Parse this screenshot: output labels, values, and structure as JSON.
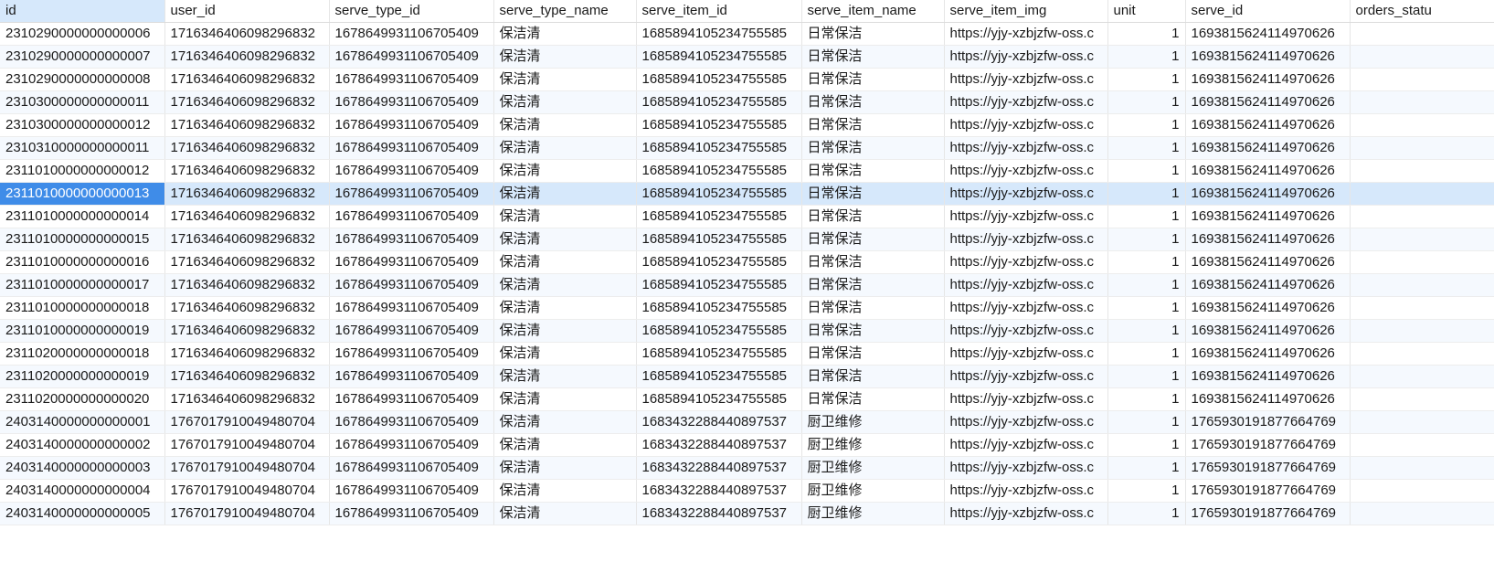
{
  "columns": [
    {
      "key": "id",
      "label": "id"
    },
    {
      "key": "user_id",
      "label": "user_id"
    },
    {
      "key": "serve_type_id",
      "label": "serve_type_id"
    },
    {
      "key": "serve_type_name",
      "label": "serve_type_name"
    },
    {
      "key": "serve_item_id",
      "label": "serve_item_id"
    },
    {
      "key": "serve_item_name",
      "label": "serve_item_name"
    },
    {
      "key": "serve_item_img",
      "label": "serve_item_img"
    },
    {
      "key": "unit",
      "label": "unit"
    },
    {
      "key": "serve_id",
      "label": "serve_id"
    },
    {
      "key": "orders_status",
      "label": "orders_statu"
    }
  ],
  "selected_row": 7,
  "rows": [
    [
      "2310290000000000006",
      "1716346406098296832",
      "1678649931106705409",
      "保洁清",
      "1685894105234755585",
      "日常保洁",
      "https://yjy-xzbjzfw-oss.c",
      "1",
      "1693815624114970626",
      ""
    ],
    [
      "2310290000000000007",
      "1716346406098296832",
      "1678649931106705409",
      "保洁清",
      "1685894105234755585",
      "日常保洁",
      "https://yjy-xzbjzfw-oss.c",
      "1",
      "1693815624114970626",
      ""
    ],
    [
      "2310290000000000008",
      "1716346406098296832",
      "1678649931106705409",
      "保洁清",
      "1685894105234755585",
      "日常保洁",
      "https://yjy-xzbjzfw-oss.c",
      "1",
      "1693815624114970626",
      ""
    ],
    [
      "2310300000000000011",
      "1716346406098296832",
      "1678649931106705409",
      "保洁清",
      "1685894105234755585",
      "日常保洁",
      "https://yjy-xzbjzfw-oss.c",
      "1",
      "1693815624114970626",
      ""
    ],
    [
      "2310300000000000012",
      "1716346406098296832",
      "1678649931106705409",
      "保洁清",
      "1685894105234755585",
      "日常保洁",
      "https://yjy-xzbjzfw-oss.c",
      "1",
      "1693815624114970626",
      ""
    ],
    [
      "2310310000000000011",
      "1716346406098296832",
      "1678649931106705409",
      "保洁清",
      "1685894105234755585",
      "日常保洁",
      "https://yjy-xzbjzfw-oss.c",
      "1",
      "1693815624114970626",
      ""
    ],
    [
      "2311010000000000012",
      "1716346406098296832",
      "1678649931106705409",
      "保洁清",
      "1685894105234755585",
      "日常保洁",
      "https://yjy-xzbjzfw-oss.c",
      "1",
      "1693815624114970626",
      ""
    ],
    [
      "2311010000000000013",
      "1716346406098296832",
      "1678649931106705409",
      "保洁清",
      "1685894105234755585",
      "日常保洁",
      "https://yjy-xzbjzfw-oss.c",
      "1",
      "1693815624114970626",
      ""
    ],
    [
      "2311010000000000014",
      "1716346406098296832",
      "1678649931106705409",
      "保洁清",
      "1685894105234755585",
      "日常保洁",
      "https://yjy-xzbjzfw-oss.c",
      "1",
      "1693815624114970626",
      ""
    ],
    [
      "2311010000000000015",
      "1716346406098296832",
      "1678649931106705409",
      "保洁清",
      "1685894105234755585",
      "日常保洁",
      "https://yjy-xzbjzfw-oss.c",
      "1",
      "1693815624114970626",
      ""
    ],
    [
      "2311010000000000016",
      "1716346406098296832",
      "1678649931106705409",
      "保洁清",
      "1685894105234755585",
      "日常保洁",
      "https://yjy-xzbjzfw-oss.c",
      "1",
      "1693815624114970626",
      ""
    ],
    [
      "2311010000000000017",
      "1716346406098296832",
      "1678649931106705409",
      "保洁清",
      "1685894105234755585",
      "日常保洁",
      "https://yjy-xzbjzfw-oss.c",
      "1",
      "1693815624114970626",
      ""
    ],
    [
      "2311010000000000018",
      "1716346406098296832",
      "1678649931106705409",
      "保洁清",
      "1685894105234755585",
      "日常保洁",
      "https://yjy-xzbjzfw-oss.c",
      "1",
      "1693815624114970626",
      ""
    ],
    [
      "2311010000000000019",
      "1716346406098296832",
      "1678649931106705409",
      "保洁清",
      "1685894105234755585",
      "日常保洁",
      "https://yjy-xzbjzfw-oss.c",
      "1",
      "1693815624114970626",
      ""
    ],
    [
      "2311020000000000018",
      "1716346406098296832",
      "1678649931106705409",
      "保洁清",
      "1685894105234755585",
      "日常保洁",
      "https://yjy-xzbjzfw-oss.c",
      "1",
      "1693815624114970626",
      ""
    ],
    [
      "2311020000000000019",
      "1716346406098296832",
      "1678649931106705409",
      "保洁清",
      "1685894105234755585",
      "日常保洁",
      "https://yjy-xzbjzfw-oss.c",
      "1",
      "1693815624114970626",
      ""
    ],
    [
      "2311020000000000020",
      "1716346406098296832",
      "1678649931106705409",
      "保洁清",
      "1685894105234755585",
      "日常保洁",
      "https://yjy-xzbjzfw-oss.c",
      "1",
      "1693815624114970626",
      ""
    ],
    [
      "2403140000000000001",
      "1767017910049480704",
      "1678649931106705409",
      "保洁清",
      "1683432288440897537",
      "厨卫维修",
      "https://yjy-xzbjzfw-oss.c",
      "1",
      "1765930191877664769",
      ""
    ],
    [
      "2403140000000000002",
      "1767017910049480704",
      "1678649931106705409",
      "保洁清",
      "1683432288440897537",
      "厨卫维修",
      "https://yjy-xzbjzfw-oss.c",
      "1",
      "1765930191877664769",
      ""
    ],
    [
      "2403140000000000003",
      "1767017910049480704",
      "1678649931106705409",
      "保洁清",
      "1683432288440897537",
      "厨卫维修",
      "https://yjy-xzbjzfw-oss.c",
      "1",
      "1765930191877664769",
      ""
    ],
    [
      "2403140000000000004",
      "1767017910049480704",
      "1678649931106705409",
      "保洁清",
      "1683432288440897537",
      "厨卫维修",
      "https://yjy-xzbjzfw-oss.c",
      "1",
      "1765930191877664769",
      ""
    ],
    [
      "2403140000000000005",
      "1767017910049480704",
      "1678649931106705409",
      "保洁清",
      "1683432288440897537",
      "厨卫维修",
      "https://yjy-xzbjzfw-oss.c",
      "1",
      "1765930191877664769",
      ""
    ]
  ]
}
